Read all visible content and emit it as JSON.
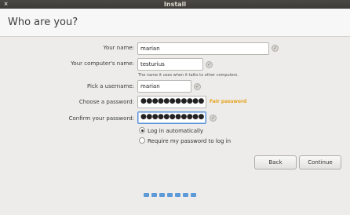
{
  "window": {
    "title": "Install",
    "close_glyph": "×"
  },
  "page": {
    "title": "Who are you?"
  },
  "form": {
    "name_label": "Your name:",
    "name_value": "marian",
    "computer_label": "Your computer's name:",
    "computer_value": "testurius",
    "computer_hint": "The name it uses when it talks to other computers.",
    "username_label": "Pick a username:",
    "username_value": "marian",
    "password_label": "Choose a password:",
    "password_value": "●●●●●●●●●●●",
    "password_strength": "Fair password",
    "confirm_label": "Confirm your password:",
    "confirm_value": "●●●●●●●●●●●",
    "check_glyph": "✓"
  },
  "login_options": [
    {
      "label": "Log in automatically",
      "selected": true
    },
    {
      "label": "Require my password to log in",
      "selected": false
    }
  ],
  "buttons": {
    "back": "Back",
    "continue": "Continue"
  },
  "progress": {
    "steps": 7,
    "current": 7
  },
  "colors": {
    "accent": "#5e9ad8",
    "strength": "#e6a11a",
    "titlebar": "#3c3b37"
  }
}
